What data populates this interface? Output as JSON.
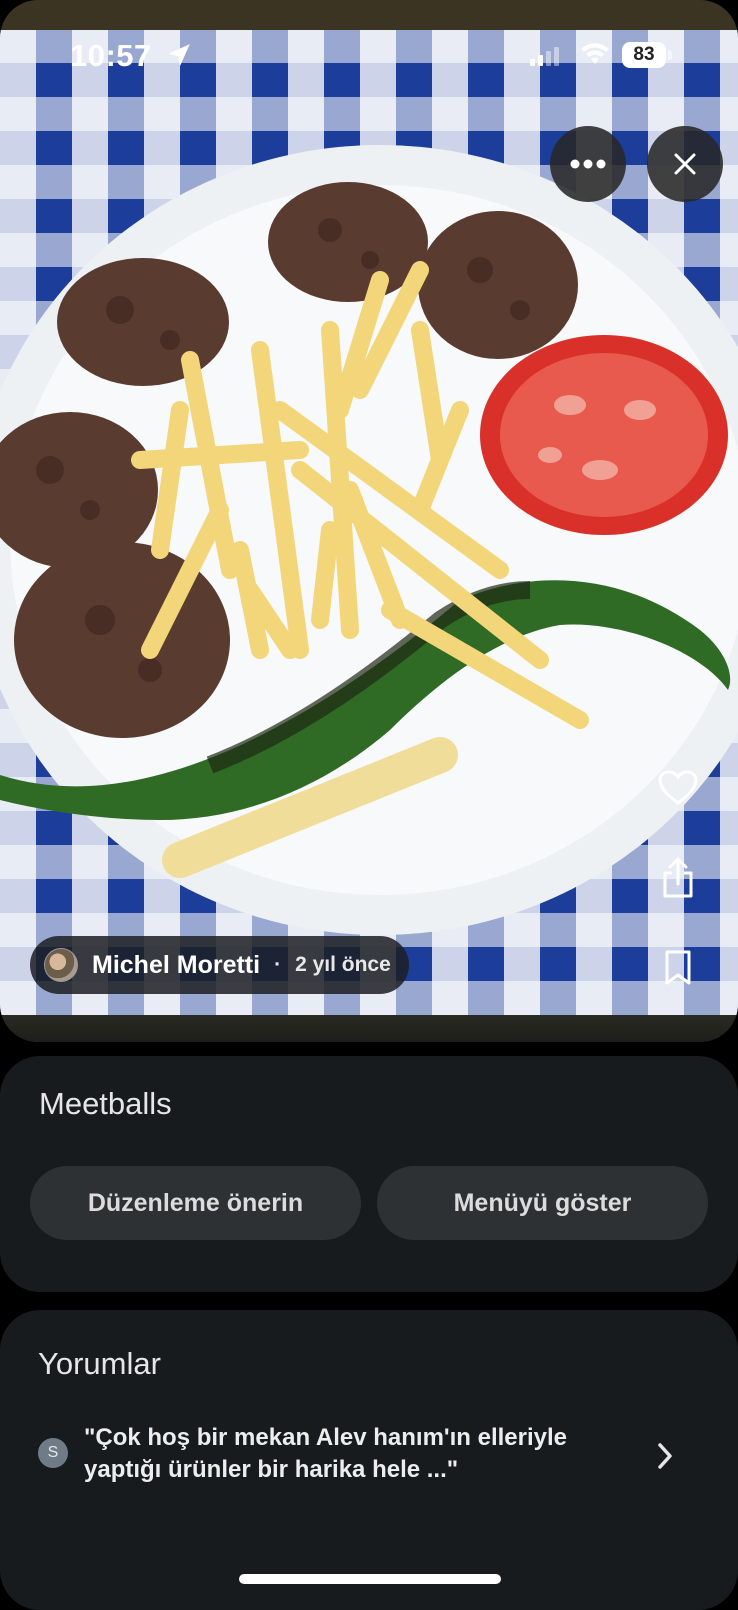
{
  "status_bar": {
    "time": "10:57",
    "battery": "83"
  },
  "photo": {
    "author_name": "Michel Moretti",
    "separator": "·",
    "posted_ago": "2 yıl önce"
  },
  "icons": {
    "location": "location-arrow-icon",
    "signal": "cellular-signal-icon",
    "wifi": "wifi-icon",
    "more": "more-horizontal-icon",
    "close": "close-icon",
    "like": "heart-icon",
    "share": "share-icon",
    "save": "bookmark-icon",
    "review_chevron": "chevron-right-icon"
  },
  "dish": {
    "title": "Meetballs",
    "suggest_edit_label": "Düzenleme önerin",
    "show_menu_label": "Menüyü göster"
  },
  "reviews": {
    "title": "Yorumlar",
    "items": [
      {
        "initial": "S",
        "text": "\"Çok hoş bir mekan Alev hanım'ın elleriyle yaptığı ürünler bir harika hele ...\""
      }
    ]
  },
  "colors": {
    "background": "#000000",
    "card": "#171b1e",
    "pill": "#2e3133",
    "tablecloth_blue": "#1d3d9a"
  }
}
